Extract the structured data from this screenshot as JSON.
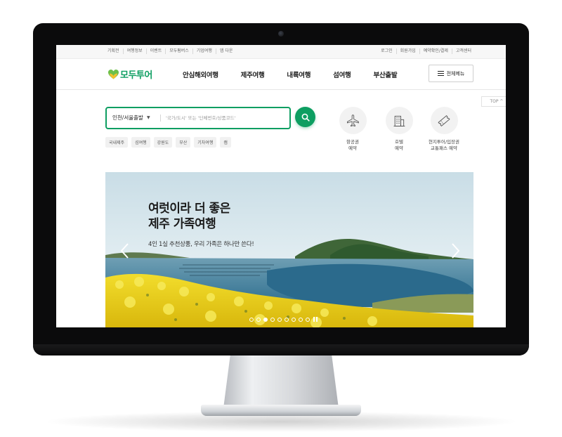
{
  "utility_left": [
    "기획전",
    "여행정보",
    "이벤트",
    "모두펌버스",
    "기업여행",
    "앱 다운"
  ],
  "utility_right": [
    "로그인",
    "회원가입",
    "예약확인/결제",
    "고객센터"
  ],
  "brand": {
    "logo_text": "모두투어",
    "color": "#0d9e61"
  },
  "nav": {
    "items": [
      "안심해외여행",
      "제주여행",
      "내륙여행",
      "섬여행",
      "부산출발"
    ],
    "all_menu": "전체메뉴"
  },
  "top_button": "TOP ^",
  "search": {
    "departure": "인천/서울출발",
    "placeholder": "'국가/도시' 또는 '단체번호/상품코드'",
    "tags": [
      "국내제주",
      "섬여행",
      "강원도",
      "부산",
      "기차여행",
      "캠"
    ]
  },
  "quick_links": [
    {
      "label": "항공권\n예약",
      "icon": "airplane-icon"
    },
    {
      "label": "호텔\n예약",
      "icon": "hotel-icon"
    },
    {
      "label": "현지투어/입장권\n교통패스 예약",
      "icon": "ticket-icon"
    }
  ],
  "banner": {
    "title": "여럿이라 더 좋은\n제주 가족여행",
    "subtitle": "4인 1실 추천상품, 우리 가족은 하나만 쓴다!",
    "slide_count": 9,
    "active_slide": 3
  }
}
